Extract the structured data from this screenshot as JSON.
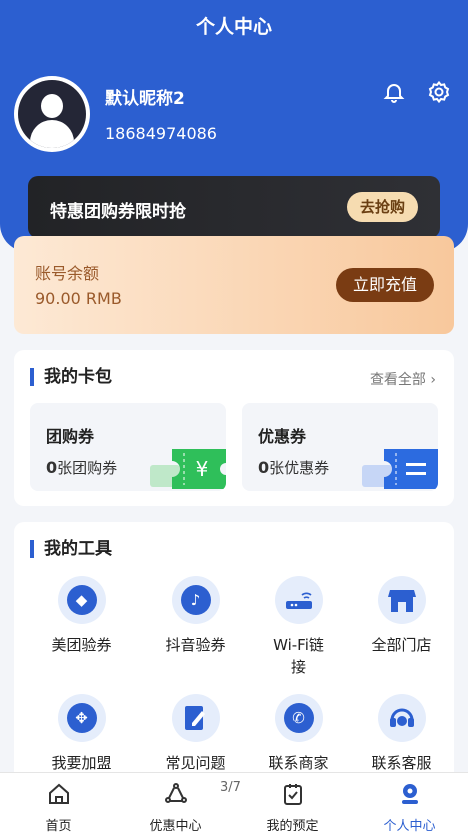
{
  "header": {
    "title": "个人中心"
  },
  "user": {
    "nickname": "默认昵称2",
    "phone": "18684974086"
  },
  "promo": {
    "text": "特惠团购券限时抢",
    "button": "去抢购"
  },
  "balance": {
    "label": "账号余额",
    "value": "90.00 RMB",
    "button": "立即充值"
  },
  "wallet": {
    "title": "我的卡包",
    "view_all": "查看全部",
    "vouchers": [
      {
        "title": "团购券",
        "count": "0",
        "unit": "张团购券"
      },
      {
        "title": "优惠券",
        "count": "0",
        "unit": "张优惠券"
      }
    ]
  },
  "tools": {
    "title": "我的工具",
    "items": [
      {
        "label": "美团验券",
        "icon": "meituan-icon"
      },
      {
        "label": "抖音验券",
        "icon": "douyin-icon"
      },
      {
        "label": "Wi-Fi链接",
        "icon": "wifi-router-icon"
      },
      {
        "label": "全部门店",
        "icon": "store-icon"
      },
      {
        "label": "我要加盟",
        "icon": "handshake-icon"
      },
      {
        "label": "常见问题",
        "icon": "edit-doc-icon"
      },
      {
        "label": "联系商家",
        "icon": "phone-chat-icon"
      },
      {
        "label": "联系客服",
        "icon": "headset-icon"
      }
    ]
  },
  "pager": "3/7",
  "nav": [
    {
      "label": "首页",
      "icon": "home-icon"
    },
    {
      "label": "优惠中心",
      "icon": "discount-icon"
    },
    {
      "label": "我的预定",
      "icon": "booking-icon"
    },
    {
      "label": "个人中心",
      "icon": "profile-icon"
    }
  ],
  "colors": {
    "brand": "#2c5fd0",
    "gold": "#f6dcb1",
    "brown": "#7a3c13",
    "ticket_green": "#2fbf5a"
  }
}
